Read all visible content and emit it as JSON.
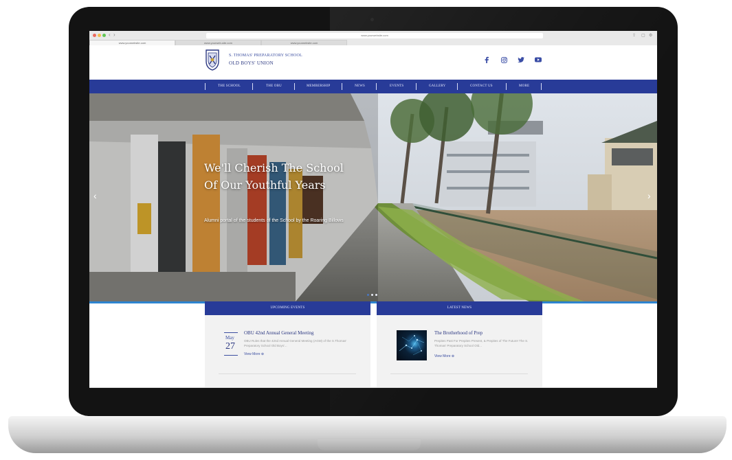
{
  "browser": {
    "address": "www.yourwebsite.com",
    "tabs": [
      "www.yourwebsite.com",
      "www.yourweb-site.com",
      "www.yourwebsite.com"
    ]
  },
  "site": {
    "school_name": "S. THOMAS' PREPARATORY SCHOOL",
    "union_name": "OLD BOYS' UNION",
    "social": [
      "facebook-icon",
      "instagram-icon",
      "twitter-icon",
      "youtube-icon"
    ],
    "brand_color": "#283b98"
  },
  "nav": {
    "items": [
      "THE SCHOOL",
      "THE OBU",
      "MEMBERSHIP",
      "NEWS",
      "EVENTS",
      "GALLERY",
      "CONTACT US",
      "MORE"
    ]
  },
  "hero": {
    "title": "We'll Cherish The School Of Our Youthful Years",
    "subtitle": "Alumni portal of the students of the School by the Roaring Billows",
    "prev_arrow": "‹",
    "next_arrow": "›"
  },
  "events": {
    "heading": "UPCOMING EVENTS",
    "item": {
      "month": "May",
      "day": "27",
      "title": "OBU 42nd Annual General Meeting",
      "text": "OBU Rules that the 42nd Annual General Meeting (AGM) of the S.Thomas' Preparatory School Old Boys'...",
      "link": "View More"
    }
  },
  "news": {
    "heading": "LATEST NEWS",
    "item": {
      "title": "The Brotherhood of Prep",
      "text": "Prepites Past For Prepites Present, & Prepites of The Future! The S. Thomas' Preparatory School Old...",
      "link": "View More"
    }
  }
}
